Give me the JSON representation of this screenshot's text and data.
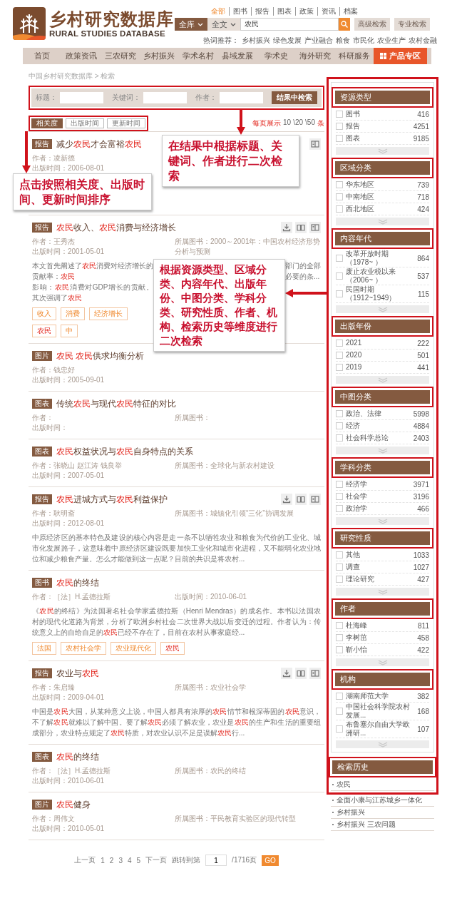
{
  "header": {
    "logo_title": "乡村研究数据库",
    "logo_subtitle": "RURAL STUDIES DATABASE",
    "scopes": [
      {
        "label": "全部",
        "selected": true
      },
      {
        "label": "图书",
        "selected": false
      },
      {
        "label": "报告",
        "selected": false
      },
      {
        "label": "图表",
        "selected": false
      },
      {
        "label": "政策",
        "selected": false
      },
      {
        "label": "资讯",
        "selected": false
      },
      {
        "label": "档案",
        "selected": false
      }
    ],
    "library_select": "全库",
    "field_select": "全文",
    "search_value": "农民",
    "buttons": [
      "高级检索",
      "专业检索"
    ],
    "hot_label": "热词推荐：",
    "hot_words": [
      "乡村振兴",
      "绿色发展",
      "产业融合",
      "粮食",
      "市民化",
      "农业生产",
      "农村金融"
    ]
  },
  "nav": [
    {
      "label": "首页",
      "kind": "link"
    },
    {
      "label": "政策资讯",
      "kind": "link"
    },
    {
      "label": "三农研究",
      "kind": "link"
    },
    {
      "label": "乡村振兴",
      "kind": "link"
    },
    {
      "label": "学术名村",
      "kind": "link"
    },
    {
      "label": "县域发展",
      "kind": "link"
    },
    {
      "label": "学术史",
      "kind": "link"
    },
    {
      "label": "海外研究",
      "kind": "link"
    },
    {
      "label": "科研服务",
      "kind": "link"
    },
    {
      "label": "产品专区",
      "kind": "featured"
    }
  ],
  "breadcrumb": "中国乡村研究数据库 > 检索",
  "filter": {
    "fields": [
      {
        "label": "标题："
      },
      {
        "label": "关键词："
      },
      {
        "label": "作者："
      }
    ],
    "button": "结果中检索"
  },
  "sort": [
    {
      "label": "相关度",
      "selected": true
    },
    {
      "label": "出版时间",
      "selected": false
    },
    {
      "label": "更新时间",
      "selected": false
    }
  ],
  "page_size": {
    "label": "每页展示",
    "options": [
      "10",
      "\\20",
      "\\50"
    ],
    "unit": "条"
  },
  "results": [
    {
      "type": "报告",
      "title": "减少**农民**才会富裕**农民**",
      "meta_left": [
        "作者：凌新德",
        "出版时间：2006-08-01"
      ],
      "actions": [
        {
          "kind": "view"
        }
      ]
    },
    {
      "type": "报告",
      "title": "**农民**收入、**农民**消费与经济增长",
      "meta_left": [
        "作者：王秀杰",
        "出版时间：2001-05-01"
      ],
      "meta_right": "所属图书：2000～2001年：中国农村经济形势分析与预测",
      "abstract_parts": [
        "本文首先阐述了**农民**消费对经济增长的贡献率：**农民**",
        "影响：**农民**消费对GDP增长的贡献。其次强调了**农民**"
      ],
      "abstract_tail": [
        "部门的全部",
        "必要的条..."
      ],
      "tags": [
        {
          "label": "收入",
          "highlight": false
        },
        {
          "label": "消费",
          "highlight": false
        },
        {
          "label": "经济增长",
          "highlight": false
        },
        {
          "label": "农民",
          "highlight": true
        },
        {
          "label": "中",
          "highlight": false
        }
      ],
      "actions": [
        {
          "kind": "download"
        },
        {
          "kind": "read"
        },
        {
          "kind": "view"
        }
      ]
    },
    {
      "type": "图片",
      "title": "**农民** **农民**供求均衡分析",
      "meta_left": [
        "作者：钱忠好",
        "出版时间：2005-09-01"
      ]
    },
    {
      "type": "图表",
      "title": "传统**农民**与现代**农民**特征的对比",
      "meta_left": [
        "作者：",
        "出版时间："
      ],
      "meta_right": "所属图书："
    },
    {
      "type": "图表",
      "title": "**农民**权益状况与**农民**自身特点的关系",
      "meta_left": [
        "作者：张晓山 赵江涛 钱良举",
        "出版时间：2007-05-01"
      ],
      "meta_right": "所属图书：全球化与新农村建设"
    },
    {
      "type": "报告",
      "title": "**农民**进城方式与**农民**利益保护",
      "meta_left": [
        "作者：耿明斋",
        "出版时间：2012-08-01"
      ],
      "meta_right": "所属图书：城镇化引领“三化”协调发展",
      "abstract": "中原经济区的基本特色及建设的核心内容是走一条不以牺牲农业和粮食为代价的工业化、城市化发展路子，这意味着中原经济区建设既要加快工业化和城市化进程，又不能弱化农业地位和减少粮食产量。怎么才能做到这一点呢？目前的共识是将农村...",
      "actions": [
        {
          "kind": "download"
        },
        {
          "kind": "read"
        },
        {
          "kind": "view"
        }
      ]
    },
    {
      "type": "图书",
      "title": "**农民**的终结",
      "meta_left": [
        "作者：［法］H.孟德拉斯"
      ],
      "meta_right": "出版时间：2010-06-01",
      "abstract": "《**农民**的终结》为法国著名社会学家孟德拉斯（Henri Mendras）的成名作。本书以法国农村的现代化道路为背景，分析了欧洲乡村社会二次世界大战以后变迁的过程。作者认为：传统意义上的自给自足的**农民**已经不存在了，目前在农村从事家庭经...",
      "tags": [
        {
          "label": "法国",
          "highlight": false
        },
        {
          "label": "农村社会学",
          "highlight": false
        },
        {
          "label": "农业现代化",
          "highlight": false
        },
        {
          "label": "农民",
          "highlight": true
        }
      ]
    },
    {
      "type": "报告",
      "title": "农业与**农民**",
      "meta_left": [
        "作者：朱启臻",
        "出版时间：2009-04-01"
      ],
      "meta_right": "所属图书：农业社会学",
      "abstract": "中国是**农民**大国，从某种意义上说，中国人都具有浓厚的**农民**情节和根深蒂固的**农民**意识，不了解**农民**就难以了解中国。要了解**农民**必须了解农业，农业是**农民**的生产和生活的重要组成部分，农业特点规定了**农民**特质，对农业认识不足是误解**农民**行...",
      "actions": [
        {
          "kind": "download"
        },
        {
          "kind": "read"
        },
        {
          "kind": "view"
        }
      ]
    },
    {
      "type": "图表",
      "title": "**农民**的终结",
      "meta_left": [
        "作者：［法］H.孟德拉斯",
        "出版时间：2010-06-01"
      ],
      "meta_right": "所属图书：农民的终结"
    },
    {
      "type": "图片",
      "title": "**农民**健身",
      "meta_left": [
        "作者：周伟文",
        "出版时间：2010-05-01"
      ],
      "meta_right": "所属图书：平民教育实验区的现代转型"
    }
  ],
  "pagination": {
    "prev": "上一页",
    "pages": [
      "1",
      "2",
      "3",
      "4",
      "5"
    ],
    "next": "下一页",
    "jump_label": "跳转到第",
    "jump_value": "1",
    "total": "/1716页",
    "go": "GO"
  },
  "sidebar": {
    "groups": [
      {
        "title": "资源类型",
        "items": [
          {
            "label": "图书",
            "count": "416",
            "checked": false
          },
          {
            "label": "报告",
            "count": "4251",
            "checked": false
          },
          {
            "label": "图表",
            "count": "9185",
            "checked": false
          }
        ]
      },
      {
        "title": "区域分类",
        "items": [
          {
            "label": "华东地区",
            "count": "739",
            "checked": false
          },
          {
            "label": "中南地区",
            "count": "718",
            "checked": false
          },
          {
            "label": "西北地区",
            "count": "424",
            "checked": false
          }
        ]
      },
      {
        "title": "内容年代",
        "items": [
          {
            "label": "改革开放时期（1978~ ）",
            "count": "864",
            "checked": false
          },
          {
            "label": "废止农业税以来（2006~ ）",
            "count": "537",
            "checked": false
          },
          {
            "label": "民国时期（1912~1949）",
            "count": "115",
            "checked": false
          }
        ]
      },
      {
        "title": "出版年份",
        "items": [
          {
            "label": "2021",
            "count": "222",
            "checked": false
          },
          {
            "label": "2020",
            "count": "501",
            "checked": false
          },
          {
            "label": "2019",
            "count": "441",
            "checked": false
          }
        ]
      },
      {
        "title": "中图分类",
        "items": [
          {
            "label": "政治、法律",
            "count": "5998",
            "checked": false
          },
          {
            "label": "经济",
            "count": "4884",
            "checked": false
          },
          {
            "label": "社会科学总论",
            "count": "2403",
            "checked": false
          }
        ]
      },
      {
        "title": "学科分类",
        "items": [
          {
            "label": "经济学",
            "count": "3971",
            "checked": false
          },
          {
            "label": "社会学",
            "count": "3196",
            "checked": false
          },
          {
            "label": "政治学",
            "count": "466",
            "checked": false
          }
        ]
      },
      {
        "title": "研究性质",
        "items": [
          {
            "label": "其他",
            "count": "1033",
            "checked": false
          },
          {
            "label": "调查",
            "count": "1027",
            "checked": false
          },
          {
            "label": "理论研究",
            "count": "427",
            "checked": false
          }
        ]
      },
      {
        "title": "作者",
        "items": [
          {
            "label": "杜海峰",
            "count": "811",
            "checked": false
          },
          {
            "label": "李树茁",
            "count": "458",
            "checked": false
          },
          {
            "label": "靳小怡",
            "count": "422",
            "checked": false
          }
        ]
      },
      {
        "title": "机构",
        "items": [
          {
            "label": "湖南师范大学",
            "count": "382",
            "checked": false
          },
          {
            "label": "中国社会科学院农村发展...",
            "count": "168",
            "checked": false
          },
          {
            "label": "布鲁塞尔自由大学欧洲研...",
            "count": "107",
            "checked": false
          }
        ]
      }
    ],
    "history": {
      "title": "检索历史",
      "items": [
        "农民",
        "全面小康与江苏城乡一体化",
        "乡村振兴",
        "乡村振兴 三农问题"
      ]
    }
  },
  "annotations": [
    {
      "kind": "filter",
      "text": "在结果中根据标题、关键词、作者进行二次检索"
    },
    {
      "kind": "sort",
      "text": "点击按照相关度、出版时间、更新时间排序"
    },
    {
      "kind": "sidebar",
      "text": "根据资源类型、区域分类、内容年代、出版年份、中图分类、学科分类、研究性质、作者、机构、检索历史等维度进行二次检索"
    }
  ]
}
